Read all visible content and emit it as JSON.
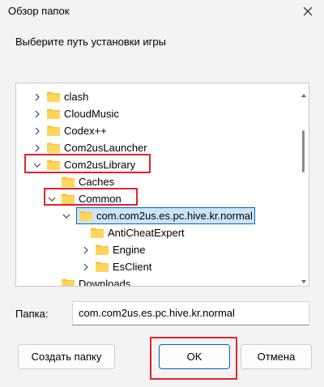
{
  "window": {
    "title": "Обзор папок"
  },
  "prompt": "Выберите путь установки игры",
  "tree": {
    "items": [
      {
        "label": "clash",
        "expander": "chevron-right"
      },
      {
        "label": "CloudMusic",
        "expander": "chevron-right"
      },
      {
        "label": "Codex++",
        "expander": "chevron-right"
      },
      {
        "label": "Com2usLauncher",
        "expander": "chevron-right"
      },
      {
        "label": "Com2usLibrary",
        "expander": "chevron-down"
      },
      {
        "label": "Caches",
        "expander": "none"
      },
      {
        "label": "Common",
        "expander": "chevron-down"
      },
      {
        "label": "com.com2us.es.pc.hive.kr.normal",
        "expander": "chevron-down",
        "selected": true
      },
      {
        "label": "AntiCheatExpert",
        "expander": "none"
      },
      {
        "label": "Engine",
        "expander": "chevron-right"
      },
      {
        "label": "EsClient",
        "expander": "chevron-right"
      },
      {
        "label": "Downloads",
        "expander": "none"
      }
    ]
  },
  "folder_field": {
    "label": "Папка:",
    "value": "com.com2us.es.pc.hive.kr.normal"
  },
  "buttons": {
    "create_folder": "Создать папку",
    "ok": "OK",
    "cancel": "Отмена"
  },
  "colors": {
    "folder": "#f5c445",
    "selection_bg": "#cce4f7",
    "selection_border": "#0067c0",
    "highlight": "#e0242b"
  },
  "icons": {
    "close": "close-icon",
    "expand": "chevron-right-icon",
    "collapse": "chevron-down-icon",
    "folder": "folder-icon"
  }
}
